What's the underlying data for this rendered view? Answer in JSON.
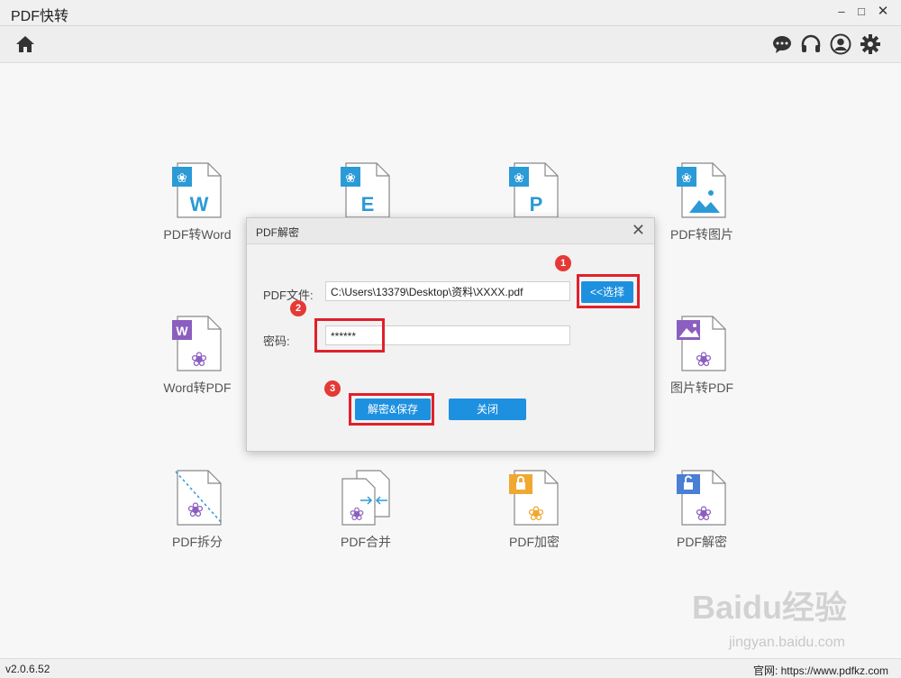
{
  "window": {
    "title": "PDF快转",
    "controls": [
      "minimize",
      "maximize",
      "close"
    ]
  },
  "toolbar": {
    "left_icons": [
      "home-icon"
    ],
    "right_icons": [
      "chat-icon",
      "headset-icon",
      "user-icon",
      "gear-icon"
    ]
  },
  "tiles": [
    {
      "label": "PDF转Word",
      "icon": "pdf-to-word-icon",
      "badge_color": "#2b9ad6",
      "letter": "W"
    },
    {
      "label": "",
      "icon": "pdf-to-excel-icon",
      "badge_color": "#2b9ad6",
      "letter": "E"
    },
    {
      "label": "",
      "icon": "pdf-to-ppt-icon",
      "badge_color": "#2b9ad6",
      "letter": "P"
    },
    {
      "label": "PDF转图片",
      "icon": "pdf-to-image-icon",
      "badge_color": "#2b9ad6"
    },
    {
      "label": "Word转PDF",
      "icon": "word-to-pdf-icon",
      "badge_color": "#8b5fbf",
      "letter": "W"
    },
    {
      "label": "图片转PDF",
      "icon": "image-to-pdf-icon",
      "badge_color": "#8b5fbf"
    },
    {
      "label": "PDF拆分",
      "icon": "pdf-split-icon"
    },
    {
      "label": "PDF合并",
      "icon": "pdf-merge-icon"
    },
    {
      "label": "PDF加密",
      "icon": "pdf-encrypt-icon",
      "badge_color": "#f0a830"
    },
    {
      "label": "PDF解密",
      "icon": "pdf-decrypt-icon",
      "badge_color": "#4a7fd4"
    }
  ],
  "dialog": {
    "title": "PDF解密",
    "file_label": "PDF文件:",
    "file_value": "C:\\Users\\13379\\Desktop\\资料\\XXXX.pdf",
    "choose_button": "<<选择",
    "password_label": "密码:",
    "password_value": "******",
    "decrypt_button": "解密&保存",
    "close_button": "关闭"
  },
  "annotations": {
    "step1": "1",
    "step2": "2",
    "step3": "3",
    "highlight_color": "#e0202a"
  },
  "status": {
    "version": "v2.0.6.52",
    "site": "官网: https://www.pdfkz.com"
  },
  "watermark": {
    "text": "Baidu经验",
    "sub": "jingyan.baidu.com"
  },
  "colors": {
    "accent": "#1e90e0",
    "pdf_red": "#c0392b"
  }
}
